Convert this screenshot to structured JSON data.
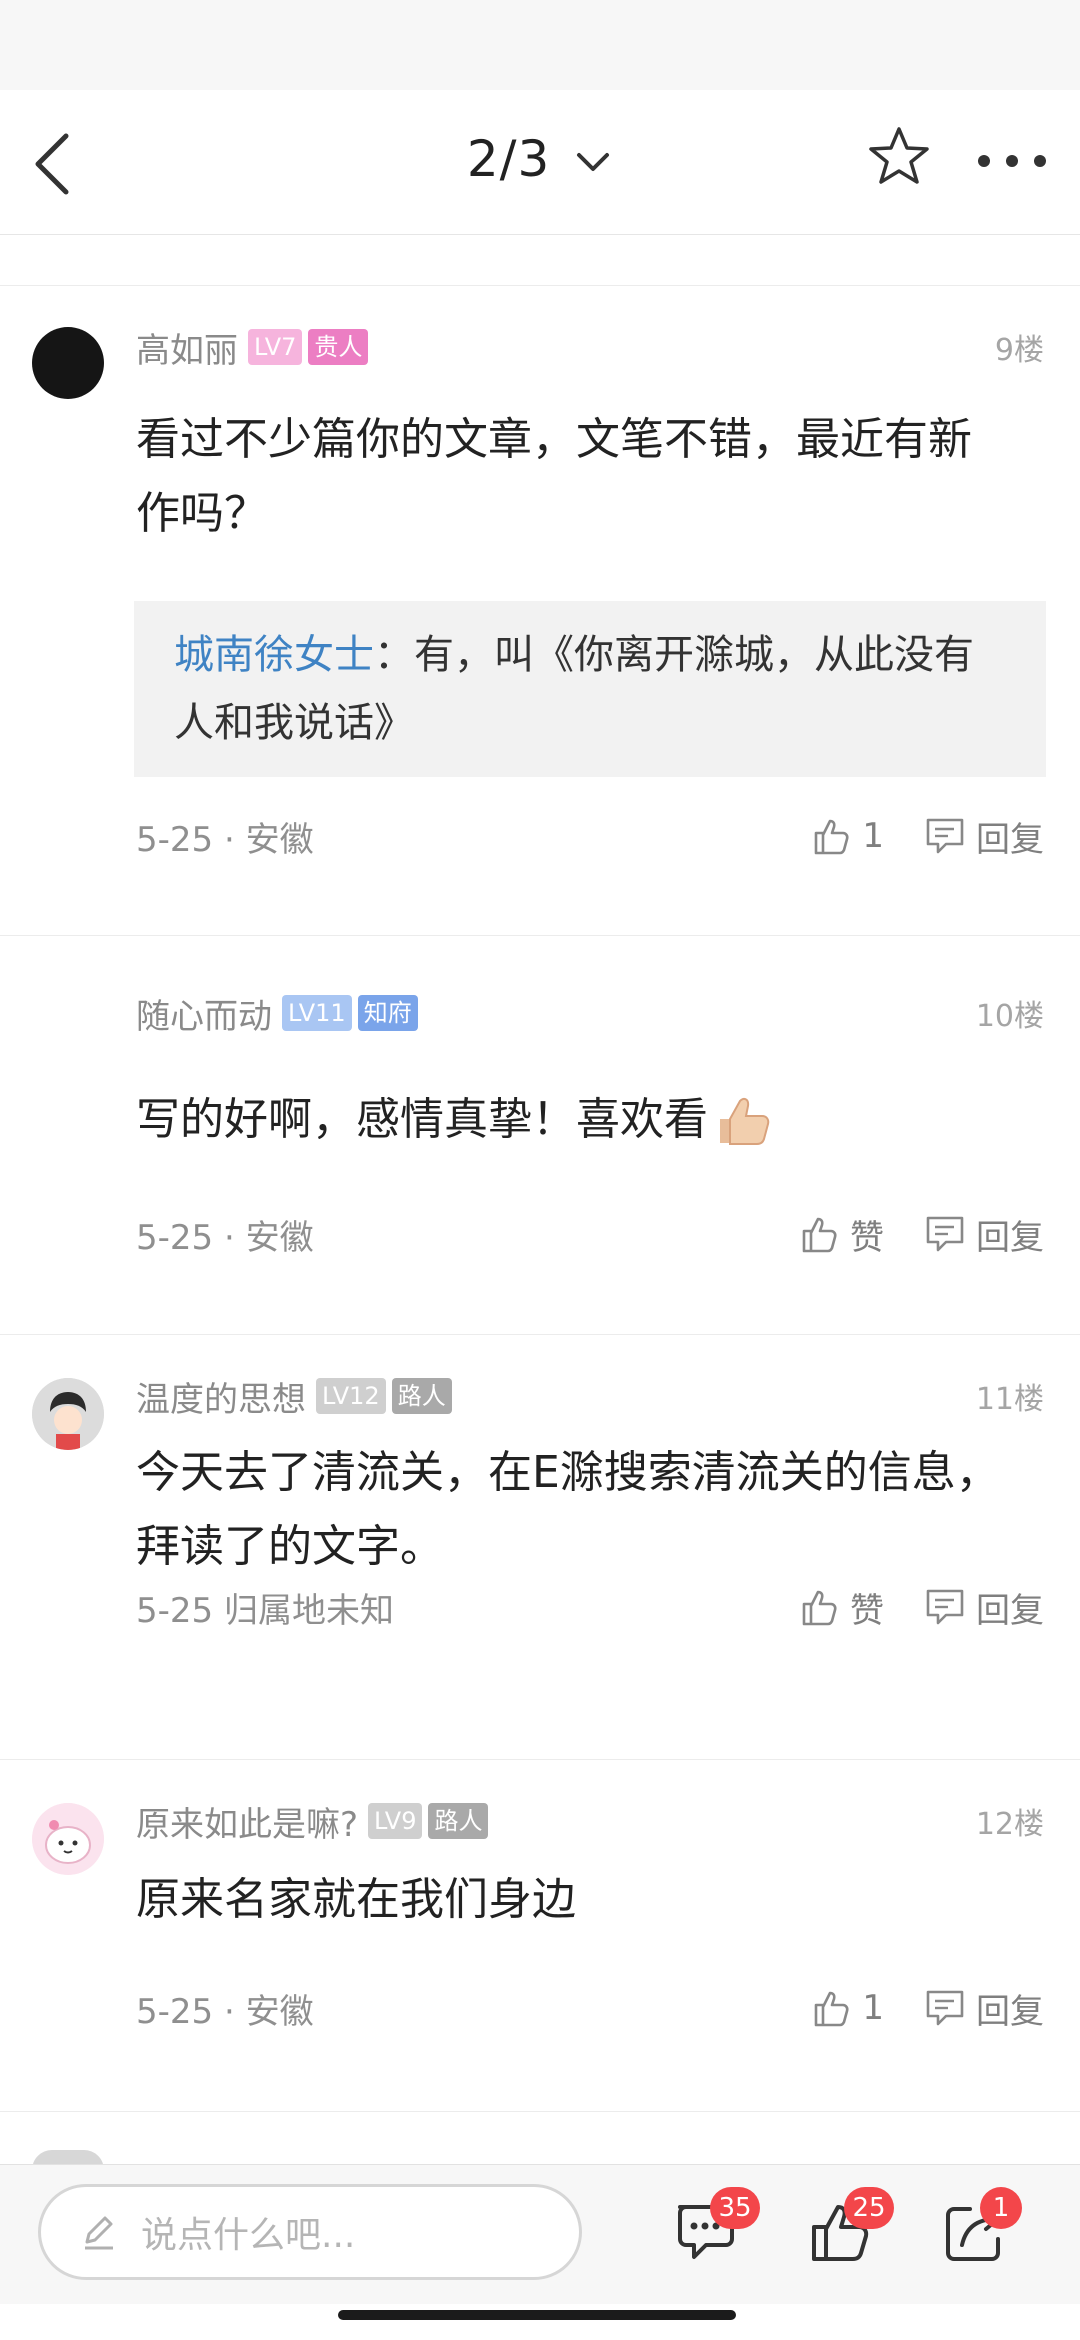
{
  "nav": {
    "page_indicator": "2/3"
  },
  "comments": [
    {
      "username": "高如丽",
      "level": "LV7",
      "rank": "贵人",
      "level_color": "#f4a9d8",
      "rank_color": "#ee7fc4",
      "floor": "9楼",
      "text": "看过不少篇你的文章，文笔不错，最近有新作吗？",
      "reply": {
        "author": "城南徐女士",
        "sep": "：",
        "text": "有，叫《你离开滁城，从此没有人和我说话》"
      },
      "date": "5-25 · 安徽",
      "likes": "1",
      "reply_label": "回复"
    },
    {
      "username": "随心而动",
      "level": "LV11",
      "rank": "知府",
      "level_color": "#a9c6f3",
      "rank_color": "#7aa4ea",
      "floor": "10楼",
      "text": "写的好啊，感情真挚！喜欢看",
      "date": "5-25 · 安徽",
      "likes": "赞",
      "reply_label": "回复"
    },
    {
      "username": "温度的思想",
      "level": "LV12",
      "rank": "路人",
      "level_color": "#c9c9c9",
      "rank_color": "#a9a9a9",
      "floor": "11楼",
      "text": "今天去了清流关，在E滁搜索清流关的信息，拜读了的文字。",
      "date": "5-25 归属地未知",
      "likes": "赞",
      "reply_label": "回复"
    },
    {
      "username": "原来如此是嘛?",
      "level": "LV9",
      "rank": "路人",
      "level_color": "#c9c9c9",
      "rank_color": "#a9a9a9",
      "floor": "12楼",
      "text": "原来名家就在我们身边",
      "date": "5-25 · 安徽",
      "likes": "1",
      "reply_label": "回复"
    }
  ],
  "bottom": {
    "placeholder": "说点什么吧...",
    "comment_count": "35",
    "like_count": "25",
    "share_count": "1"
  },
  "icons": [
    "back-arrow-icon",
    "chevron-down-icon",
    "star-icon",
    "more-dots-icon",
    "thumbs-up-icon",
    "comment-bubble-icon",
    "pencil-icon",
    "share-icon",
    "thumbs-up-emoji"
  ]
}
